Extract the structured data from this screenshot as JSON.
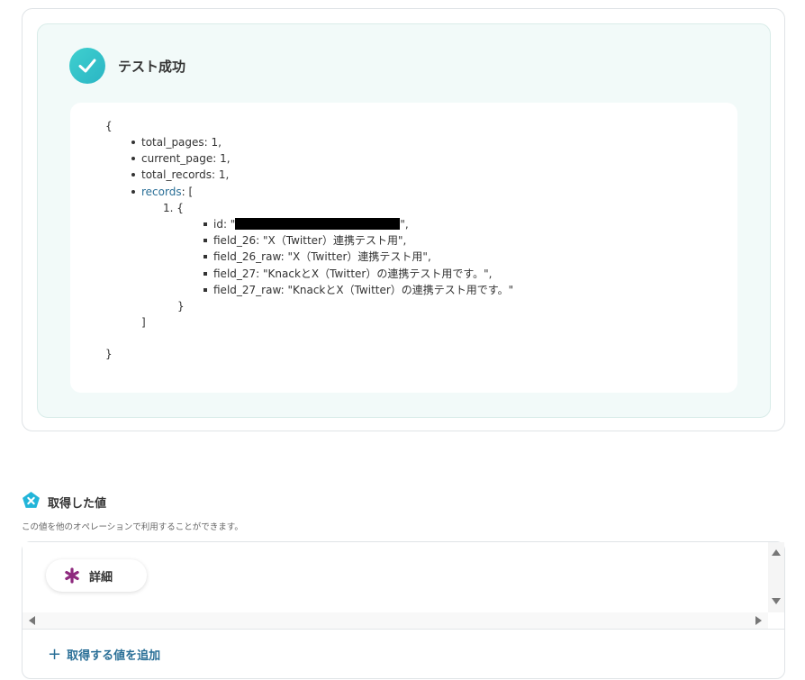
{
  "result": {
    "title": "テスト成功",
    "status_color": "#2bb5c4"
  },
  "json": {
    "open_brace": "{",
    "close_brace": "}",
    "total_pages": "total_pages: 1,",
    "current_page": "current_page: 1,",
    "total_records": "total_records: 1,",
    "records_key": "records",
    "records_suffix": ": [",
    "item_index": "1. {",
    "item_close": "}",
    "array_close": "]",
    "id_prefix": "id: \"",
    "id_suffix": "\",",
    "field_26": "field_26: \"X（Twitter）連携テスト用\",",
    "field_26_raw": "field_26_raw: \"X（Twitter）連携テスト用\",",
    "field_27": "field_27: \"KnackとX（Twitter）の連携テスト用です。\",",
    "field_27_raw": "field_27_raw: \"KnackとX（Twitter）の連携テスト用です。\""
  },
  "values": {
    "title": "取得した値",
    "description": "この値を他のオペレーションで利用することができます。",
    "chip_label": "詳細",
    "add_label": "取得する値を追加",
    "add_icon": "+",
    "accent_color": "#2a6f97",
    "chip_icon_color": "#8e2a7e"
  }
}
